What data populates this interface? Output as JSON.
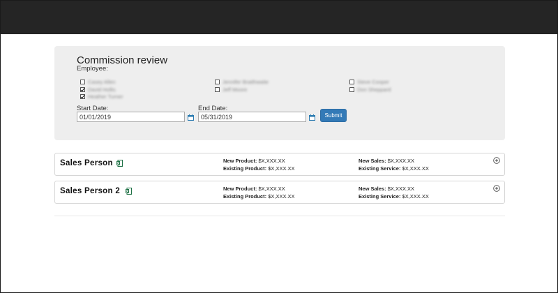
{
  "filter": {
    "title": "Commission review",
    "employee_label": "Employee:",
    "employees": [
      {
        "name": "Casey Allen",
        "checked": false
      },
      {
        "name": "David Hollis",
        "checked": true
      },
      {
        "name": "Heather Turner",
        "checked": true
      },
      {
        "name": "Jennifer Braithwaite",
        "checked": false
      },
      {
        "name": "Jeff Moore",
        "checked": false
      },
      {
        "name": "Steve Cooper",
        "checked": false
      },
      {
        "name": "Don Sheppard",
        "checked": false
      }
    ],
    "start_label": "Start Date:",
    "start_value": "01/01/2019",
    "end_label": "End Date:",
    "end_value": "05/31/2019",
    "submit_label": "Submit"
  },
  "results": [
    {
      "name": "Sales Person",
      "new_product_label": "New Product:",
      "new_product_value": "$X,XXX.XX",
      "existing_product_label": "Existing Product:",
      "existing_product_value": "$X,XXX.XX",
      "new_sales_label": "New Sales:",
      "new_sales_value": "$X,XXX.XX",
      "existing_service_label": "Existing Service:",
      "existing_service_value": "$X,XXX.XX"
    },
    {
      "name": "Sales Person 2",
      "new_product_label": "New Product:",
      "new_product_value": "$X,XXX.XX",
      "existing_product_label": "Existing Product:",
      "existing_product_value": "$X,XXX.XX",
      "new_sales_label": "New Sales:",
      "new_sales_value": "$X,XXX.XX",
      "existing_service_label": "Existing Service:",
      "existing_service_value": "$X,XXX.XX"
    }
  ],
  "icons": {
    "calendar": "calendar-icon",
    "excel": "excel-icon",
    "expand": "expand-circle-icon"
  },
  "colors": {
    "topbar": "#252525",
    "panel": "#eeeeee",
    "submit": "#337ab7",
    "excel": "#1e7145"
  }
}
